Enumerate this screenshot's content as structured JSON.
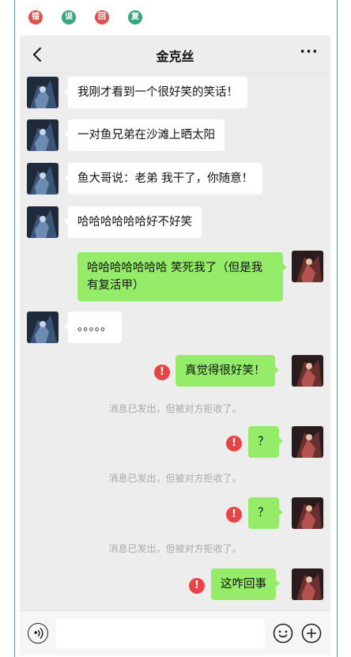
{
  "badges": [
    {
      "text": "错",
      "color": "#d9534f"
    },
    {
      "text": "误",
      "color": "#3aa57a"
    },
    {
      "text": "回",
      "color": "#d9534f"
    },
    {
      "text": "复",
      "color": "#3aa57a"
    }
  ],
  "header": {
    "title": "金克丝",
    "back_icon": "chevron-left-icon",
    "more_label": "···"
  },
  "messages": [
    {
      "side": "left",
      "text": "我刚才看到一个很好笑的笑话！"
    },
    {
      "side": "left",
      "text": "一对鱼兄弟在沙滩上晒太阳"
    },
    {
      "side": "left",
      "text": "鱼大哥说：老弟 我干了，你随意！"
    },
    {
      "side": "left",
      "text": "哈哈哈哈哈哈好不好笑"
    },
    {
      "side": "right",
      "text": "哈哈哈哈哈哈哈 笑死我了（但是我有复活甲）"
    },
    {
      "side": "left",
      "text": "。。。。。"
    },
    {
      "side": "right",
      "text": "真觉得很好笑！",
      "failed": true,
      "notice": "消息已发出，但被对方拒收了。"
    },
    {
      "side": "right",
      "text": "？",
      "failed": true,
      "notice": "消息已发出，但被对方拒收了。"
    },
    {
      "side": "right",
      "text": "？",
      "failed": true,
      "notice": "消息已发出，但被对方拒收了。"
    },
    {
      "side": "right",
      "text": "这咋回事",
      "failed": true
    }
  ],
  "error_mark": "!",
  "input_bar": {
    "placeholder": "",
    "icons": [
      "voice-icon",
      "emoji-icon",
      "plus-icon"
    ]
  },
  "colors": {
    "chat_bg": "#ededed",
    "sent_bubble": "#95ec69",
    "received_bubble": "#ffffff",
    "error": "#e54545"
  }
}
